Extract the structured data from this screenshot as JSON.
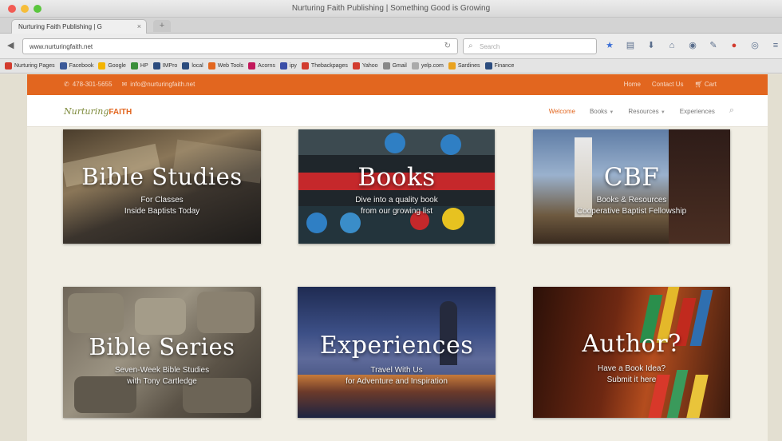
{
  "window": {
    "title": "Nurturing Faith Publishing | Something Good is Growing"
  },
  "tab": {
    "label": "Nurturing Faith Publishing | G",
    "close": "×",
    "new_tab": "+"
  },
  "navbar": {
    "back": "◀",
    "url": "www.nurturingfaith.net",
    "reload": "↻",
    "search_placeholder": "Search"
  },
  "bookmarks": [
    {
      "label": "Nurturing Pages",
      "color": "#d23b2e"
    },
    {
      "label": "Facebook",
      "color": "#3b5998"
    },
    {
      "label": "Google",
      "color": "#f4b400"
    },
    {
      "label": "HP",
      "color": "#3a8f3a"
    },
    {
      "label": "IMPro",
      "color": "#2b4c7e"
    },
    {
      "label": "local",
      "color": "#2b4c7e"
    },
    {
      "label": "Web Tools",
      "color": "#e2661f"
    },
    {
      "label": "Acorns",
      "color": "#c2185b"
    },
    {
      "label": "ipy",
      "color": "#3b4fa8"
    },
    {
      "label": "Thebackpages",
      "color": "#d23b2e"
    },
    {
      "label": "Yahoo",
      "color": "#d23b2e"
    },
    {
      "label": "Gmail",
      "color": "#888888"
    },
    {
      "label": "yelp.com",
      "color": "#aaaaaa"
    },
    {
      "label": "Sardines",
      "color": "#e9a21f"
    },
    {
      "label": "Finance",
      "color": "#2b4c7e"
    }
  ],
  "site": {
    "topbar": {
      "phone": "478-301-5655",
      "email": "info@nurturingfaith.net",
      "links": [
        "Home",
        "Contact Us",
        "Cart"
      ]
    },
    "logo": {
      "script": "Nurturing",
      "word": "FAITH"
    },
    "menu": [
      {
        "label": "Welcome",
        "active": true,
        "caret": false
      },
      {
        "label": "Books",
        "active": false,
        "caret": true
      },
      {
        "label": "Resources",
        "active": false,
        "caret": true
      },
      {
        "label": "Experiences",
        "active": false,
        "caret": false
      }
    ],
    "tiles": [
      {
        "title": "Bible Studies",
        "sub1": "For Classes",
        "sub2": "Inside Baptists Today"
      },
      {
        "title": "Books",
        "sub1": "Dive into a quality book",
        "sub2": "from our growing list"
      },
      {
        "title": "CBF",
        "sub1": "Books & Resources",
        "sub2": "Cooperative Baptist Fellowship"
      },
      {
        "title": "Bible Series",
        "sub1": "Seven-Week Bible Studies",
        "sub2": "with Tony Cartledge"
      },
      {
        "title": "Experiences",
        "sub1": "Travel With Us",
        "sub2": "for Adventure and Inspiration"
      },
      {
        "title": "Author?",
        "sub1": "Have a Book Idea?",
        "sub2": "Submit it here"
      }
    ]
  },
  "colors": {
    "accent": "#e2661f",
    "page_bg": "#f1eee4"
  },
  "icons": [
    "back-arrow-icon",
    "reload-icon",
    "search-icon",
    "bookmark-star-icon",
    "phone-icon",
    "email-icon",
    "cart-icon"
  ]
}
